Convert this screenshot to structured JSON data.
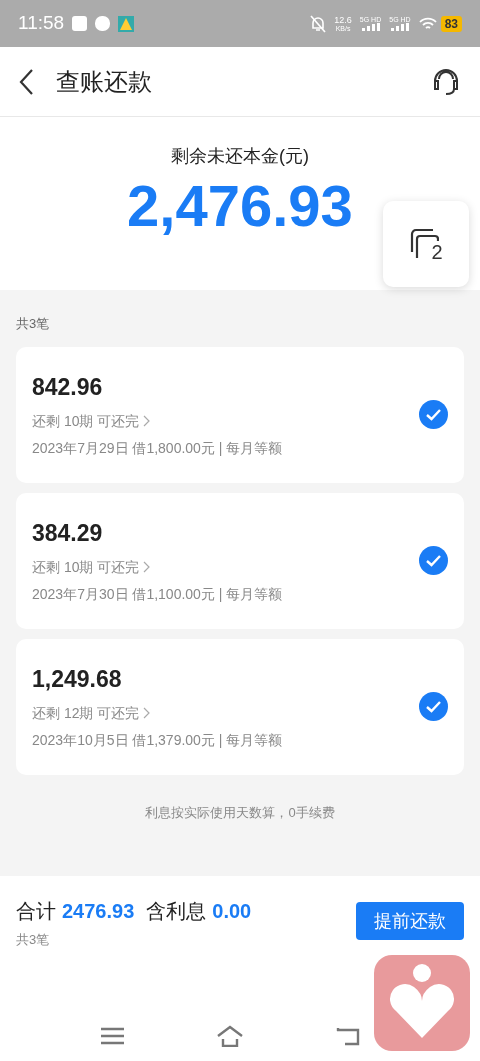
{
  "status_bar": {
    "time": "11:58",
    "speed": "12.6",
    "speed_unit": "KB/s",
    "sim": [
      "5G HD",
      "5G HD"
    ],
    "battery": "83"
  },
  "header": {
    "title": "查账还款"
  },
  "summary": {
    "label": "剩余未还本金(元)",
    "amount": "2,476.93",
    "float_badge": "2"
  },
  "count_label": "共3笔",
  "loans": [
    {
      "amount": "842.96",
      "remaining": "还剩 10期 可还完",
      "detail": "2023年7月29日 借1,800.00元 | 每月等额",
      "selected": true
    },
    {
      "amount": "384.29",
      "remaining": "还剩 10期 可还完",
      "detail": "2023年7月30日 借1,100.00元 | 每月等额",
      "selected": true
    },
    {
      "amount": "1,249.68",
      "remaining": "还剩 12期 可还完",
      "detail": "2023年10月5日 借1,379.00元 | 每月等额",
      "selected": true
    }
  ],
  "note": "利息按实际使用天数算，0手续费",
  "footer": {
    "total_label": "合计",
    "total": "2476.93",
    "interest_label": "含利息",
    "interest": "0.00",
    "count": "共3笔",
    "button": "提前还款"
  }
}
